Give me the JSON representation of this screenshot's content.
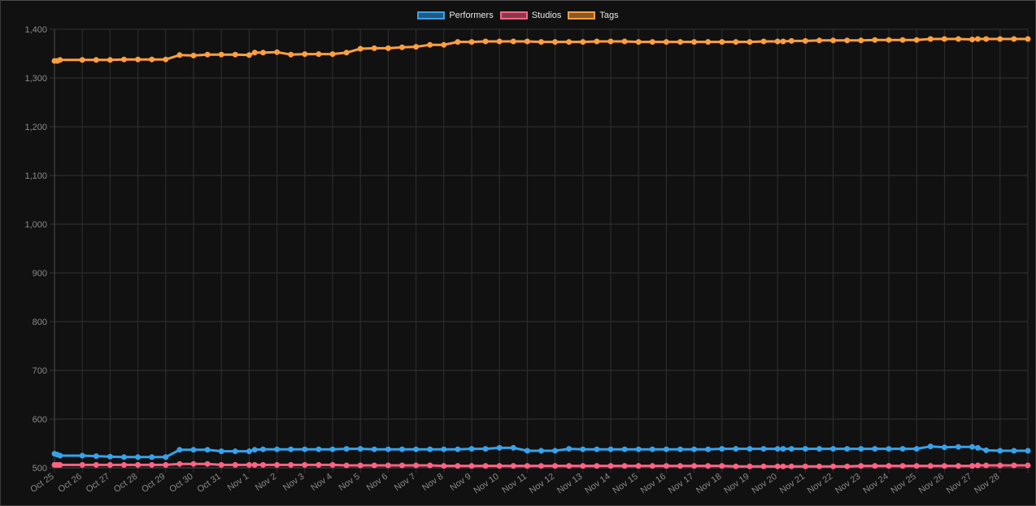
{
  "chart_data": {
    "type": "line",
    "title": "",
    "xlabel": "",
    "ylabel": "",
    "ylim": [
      500,
      1400
    ],
    "yticks": [
      500,
      600,
      700,
      800,
      900,
      1000,
      1100,
      1200,
      1300,
      1400
    ],
    "ytick_labels": [
      "500",
      "600",
      "700",
      "800",
      "900",
      "1,000",
      "1,100",
      "1,200",
      "1,300",
      "1,400"
    ],
    "grid": true,
    "legend_position": "top-center",
    "x_categories": [
      "Oct 25",
      "Oct 26",
      "Oct 27",
      "Oct 28",
      "Oct 29",
      "Oct 30",
      "Oct 31",
      "Nov 1",
      "Nov 2",
      "Nov 3",
      "Nov 4",
      "Nov 5",
      "Nov 6",
      "Nov 7",
      "Nov 8",
      "Nov 9",
      "Nov 10",
      "Nov 11",
      "Nov 12",
      "Nov 13",
      "Nov 14",
      "Nov 15",
      "Nov 16",
      "Nov 17",
      "Nov 18",
      "Nov 19",
      "Nov 20",
      "Nov 21",
      "Nov 22",
      "Nov 23",
      "Nov 24",
      "Nov 25",
      "Nov 26",
      "Nov 27",
      "Nov 28"
    ],
    "x": [
      0,
      0.1,
      0.2,
      1,
      1.5,
      2,
      2.5,
      3,
      3.5,
      4,
      4.5,
      5,
      5.5,
      6,
      6.5,
      7,
      7.2,
      7.5,
      8,
      8.5,
      9,
      9.5,
      10,
      10.5,
      11,
      11.5,
      12,
      12.5,
      13,
      13.5,
      14,
      14.5,
      15,
      15.5,
      16,
      16.5,
      17,
      17.5,
      18,
      18.5,
      19,
      19.5,
      20,
      20.5,
      21,
      21.5,
      22,
      22.5,
      23,
      23.5,
      24,
      24.5,
      25,
      25.5,
      26,
      26.2,
      26.5,
      27,
      27.5,
      28,
      28.5,
      29,
      29.5,
      30,
      30.5,
      31,
      31.5,
      32,
      32.5,
      33,
      33.2,
      33.5,
      34,
      34.5,
      35
    ],
    "series": [
      {
        "name": "Performers",
        "color": "#36a2eb",
        "values": [
          529,
          527,
          525,
          525,
          524,
          523,
          522,
          522,
          522,
          522,
          537,
          537,
          537,
          534,
          534,
          534,
          537,
          538,
          538,
          538,
          538,
          538,
          538,
          539,
          539,
          538,
          538,
          538,
          538,
          538,
          538,
          538,
          539,
          539,
          541,
          541,
          535,
          535,
          535,
          539,
          538,
          538,
          538,
          538,
          538,
          538,
          538,
          538,
          538,
          538,
          539,
          539,
          539,
          539,
          539,
          539,
          539,
          539,
          539,
          539,
          539,
          539,
          539,
          539,
          539,
          539,
          544,
          542,
          543,
          543,
          541,
          536,
          535,
          535,
          535
        ]
      },
      {
        "name": "Studios",
        "color": "#ff6384",
        "values": [
          506,
          506,
          506,
          506,
          506,
          506,
          506,
          506,
          506,
          506,
          508,
          508,
          508,
          506,
          506,
          506,
          506,
          506,
          506,
          506,
          506,
          506,
          506,
          505,
          505,
          505,
          505,
          505,
          505,
          505,
          504,
          504,
          504,
          504,
          504,
          504,
          504,
          504,
          504,
          504,
          504,
          504,
          504,
          504,
          504,
          504,
          504,
          504,
          504,
          504,
          504,
          503,
          503,
          503,
          503,
          503,
          503,
          503,
          503,
          503,
          503,
          504,
          504,
          504,
          504,
          504,
          504,
          504,
          504,
          504,
          505,
          505,
          505,
          505,
          505
        ]
      },
      {
        "name": "Tags",
        "color": "#ff9f40",
        "values": [
          1335,
          1335,
          1337,
          1337,
          1337,
          1337,
          1338,
          1338,
          1338,
          1338,
          1347,
          1346,
          1348,
          1348,
          1348,
          1347,
          1352,
          1352,
          1353,
          1348,
          1349,
          1349,
          1349,
          1352,
          1360,
          1361,
          1361,
          1363,
          1364,
          1368,
          1368,
          1374,
          1374,
          1375,
          1375,
          1375,
          1375,
          1374,
          1374,
          1374,
          1374,
          1375,
          1375,
          1375,
          1374,
          1374,
          1374,
          1374,
          1374,
          1374,
          1374,
          1374,
          1374,
          1375,
          1375,
          1375,
          1376,
          1376,
          1377,
          1377,
          1377,
          1377,
          1378,
          1378,
          1378,
          1378,
          1380,
          1380,
          1380,
          1379,
          1380,
          1380,
          1380,
          1380,
          1380
        ]
      }
    ]
  }
}
